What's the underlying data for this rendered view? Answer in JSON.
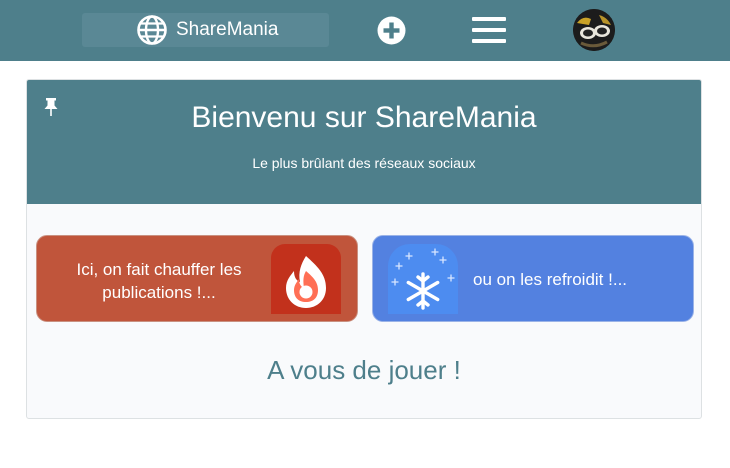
{
  "navbar": {
    "brand_name": "ShareMania",
    "brand_icon": "globe-icon",
    "add_icon": "plus-circle-icon",
    "menu_icon": "hamburger-menu-icon",
    "avatar_icon": "user-avatar"
  },
  "hero": {
    "pin_icon": "pin-icon",
    "title": "Bienvenu sur ShareMania",
    "subtitle": "Le plus brûlant des réseaux sociaux"
  },
  "actions": {
    "hot": {
      "label": "Ici, on fait chauffer les publications !...",
      "icon": "flame-icon",
      "color": "#c0553b"
    },
    "cold": {
      "label": "ou on les refroidit !...",
      "icon": "snowflake-icon",
      "color": "#5381e0"
    }
  },
  "footer_text": "A vous de jouer !",
  "colors": {
    "primary": "#4e7f8b",
    "hot": "#c0553b",
    "cold": "#5381e0"
  }
}
